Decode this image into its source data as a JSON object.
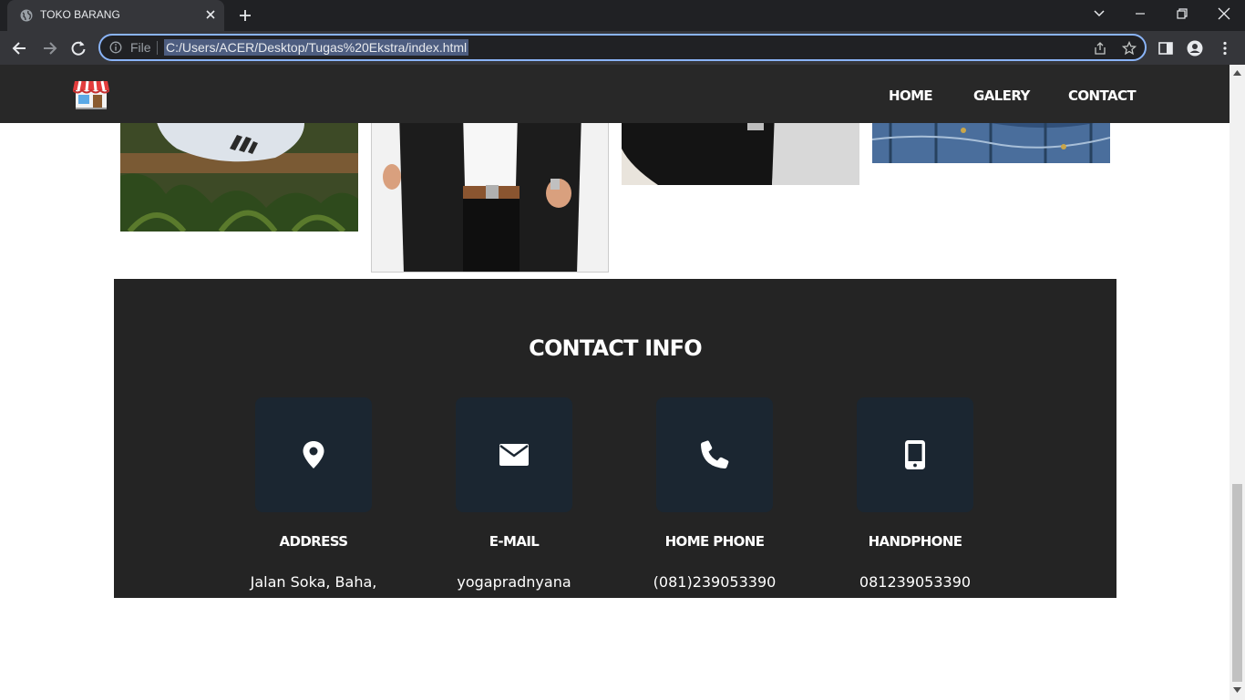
{
  "browser": {
    "tab_title": "TOKO BARANG",
    "omnibox_scheme": "File",
    "url": "C:/Users/ACER/Desktop/Tugas%20Ekstra/index.html"
  },
  "site_nav": {
    "links": [
      "HOME",
      "GALERY",
      "CONTACT"
    ]
  },
  "contact": {
    "title": "CONTACT INFO",
    "cards": [
      {
        "icon": "map-marker-icon",
        "label": "ADDRESS",
        "value": "Jalan Soka, Baha,"
      },
      {
        "icon": "envelope-icon",
        "label": "E-MAIL",
        "value": "yogapradnyana"
      },
      {
        "icon": "phone-icon",
        "label": "HOME PHONE",
        "value": "(081)239053390"
      },
      {
        "icon": "mobile-icon",
        "label": "HANDPHONE",
        "value": "081239053390"
      }
    ]
  },
  "colors": {
    "chrome_dark": "#202124",
    "chrome_toolbar": "#35363a",
    "omnibox_focus": "#8ab4f8",
    "site_nav_bg": "#282828",
    "contact_bg": "#242424",
    "icon_box_bg": "#1b2631"
  }
}
